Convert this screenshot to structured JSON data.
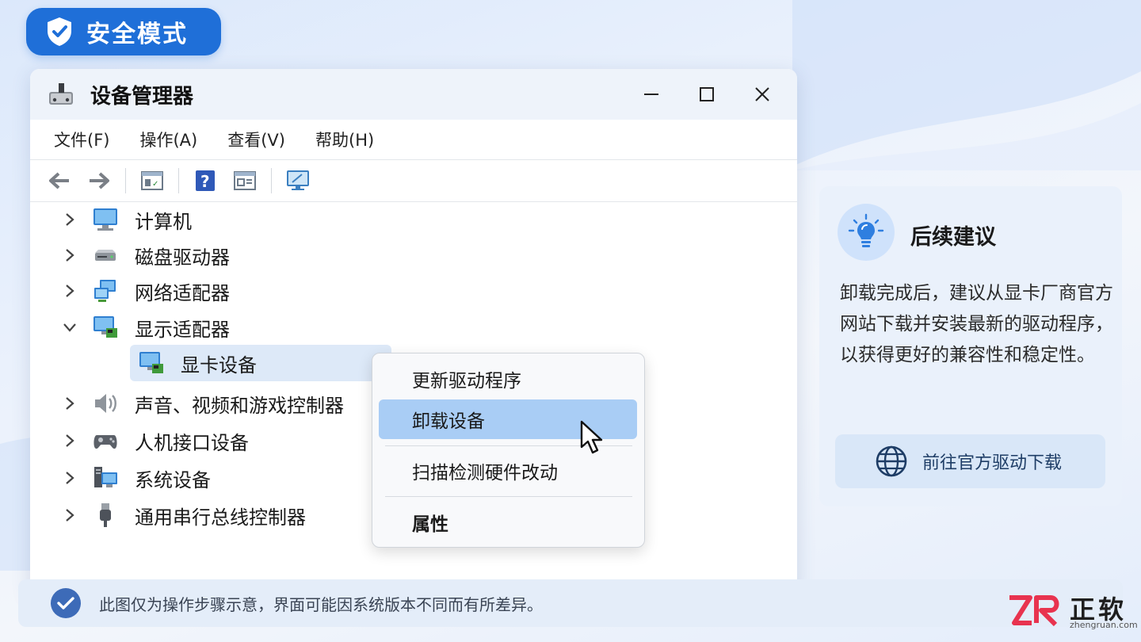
{
  "badge": {
    "label": "安全模式"
  },
  "window": {
    "title": "设备管理器",
    "menu": [
      "文件(F)",
      "操作(A)",
      "查看(V)",
      "帮助(H)"
    ]
  },
  "tree": {
    "items": [
      {
        "label": "计算机",
        "expanded": false
      },
      {
        "label": "磁盘驱动器",
        "expanded": false
      },
      {
        "label": "网络适配器",
        "expanded": false
      },
      {
        "label": "显示适配器",
        "expanded": true
      },
      {
        "label": "显卡设备",
        "child": true,
        "selected": true
      },
      {
        "label": "声音、视频和游戏控制器",
        "expanded": false
      },
      {
        "label": "人机接口设备",
        "expanded": false
      },
      {
        "label": "系统设备",
        "expanded": false
      },
      {
        "label": "通用串行总线控制器",
        "expanded": false
      }
    ]
  },
  "context_menu": {
    "items": [
      "更新驱动程序",
      "卸载设备",
      "扫描检测硬件改动",
      "属性"
    ],
    "highlighted": "卸载设备"
  },
  "side_card": {
    "title": "后续建议",
    "text": "卸载完成后，建议从显卡厂商官方网站下载并安装最新的驱动程序，以获得更好的兼容性和稳定性。",
    "button": "前往官方驱动下载"
  },
  "footer": {
    "note": "此图仅为操作步骤示意，界面可能因系统版本不同而有所差异。"
  },
  "logo": {
    "text": "正软",
    "url": "zhengruan.com"
  },
  "colors": {
    "accent": "#1f6fd8",
    "highlight": "#a9cdf5",
    "card": "#eaf1fb"
  }
}
